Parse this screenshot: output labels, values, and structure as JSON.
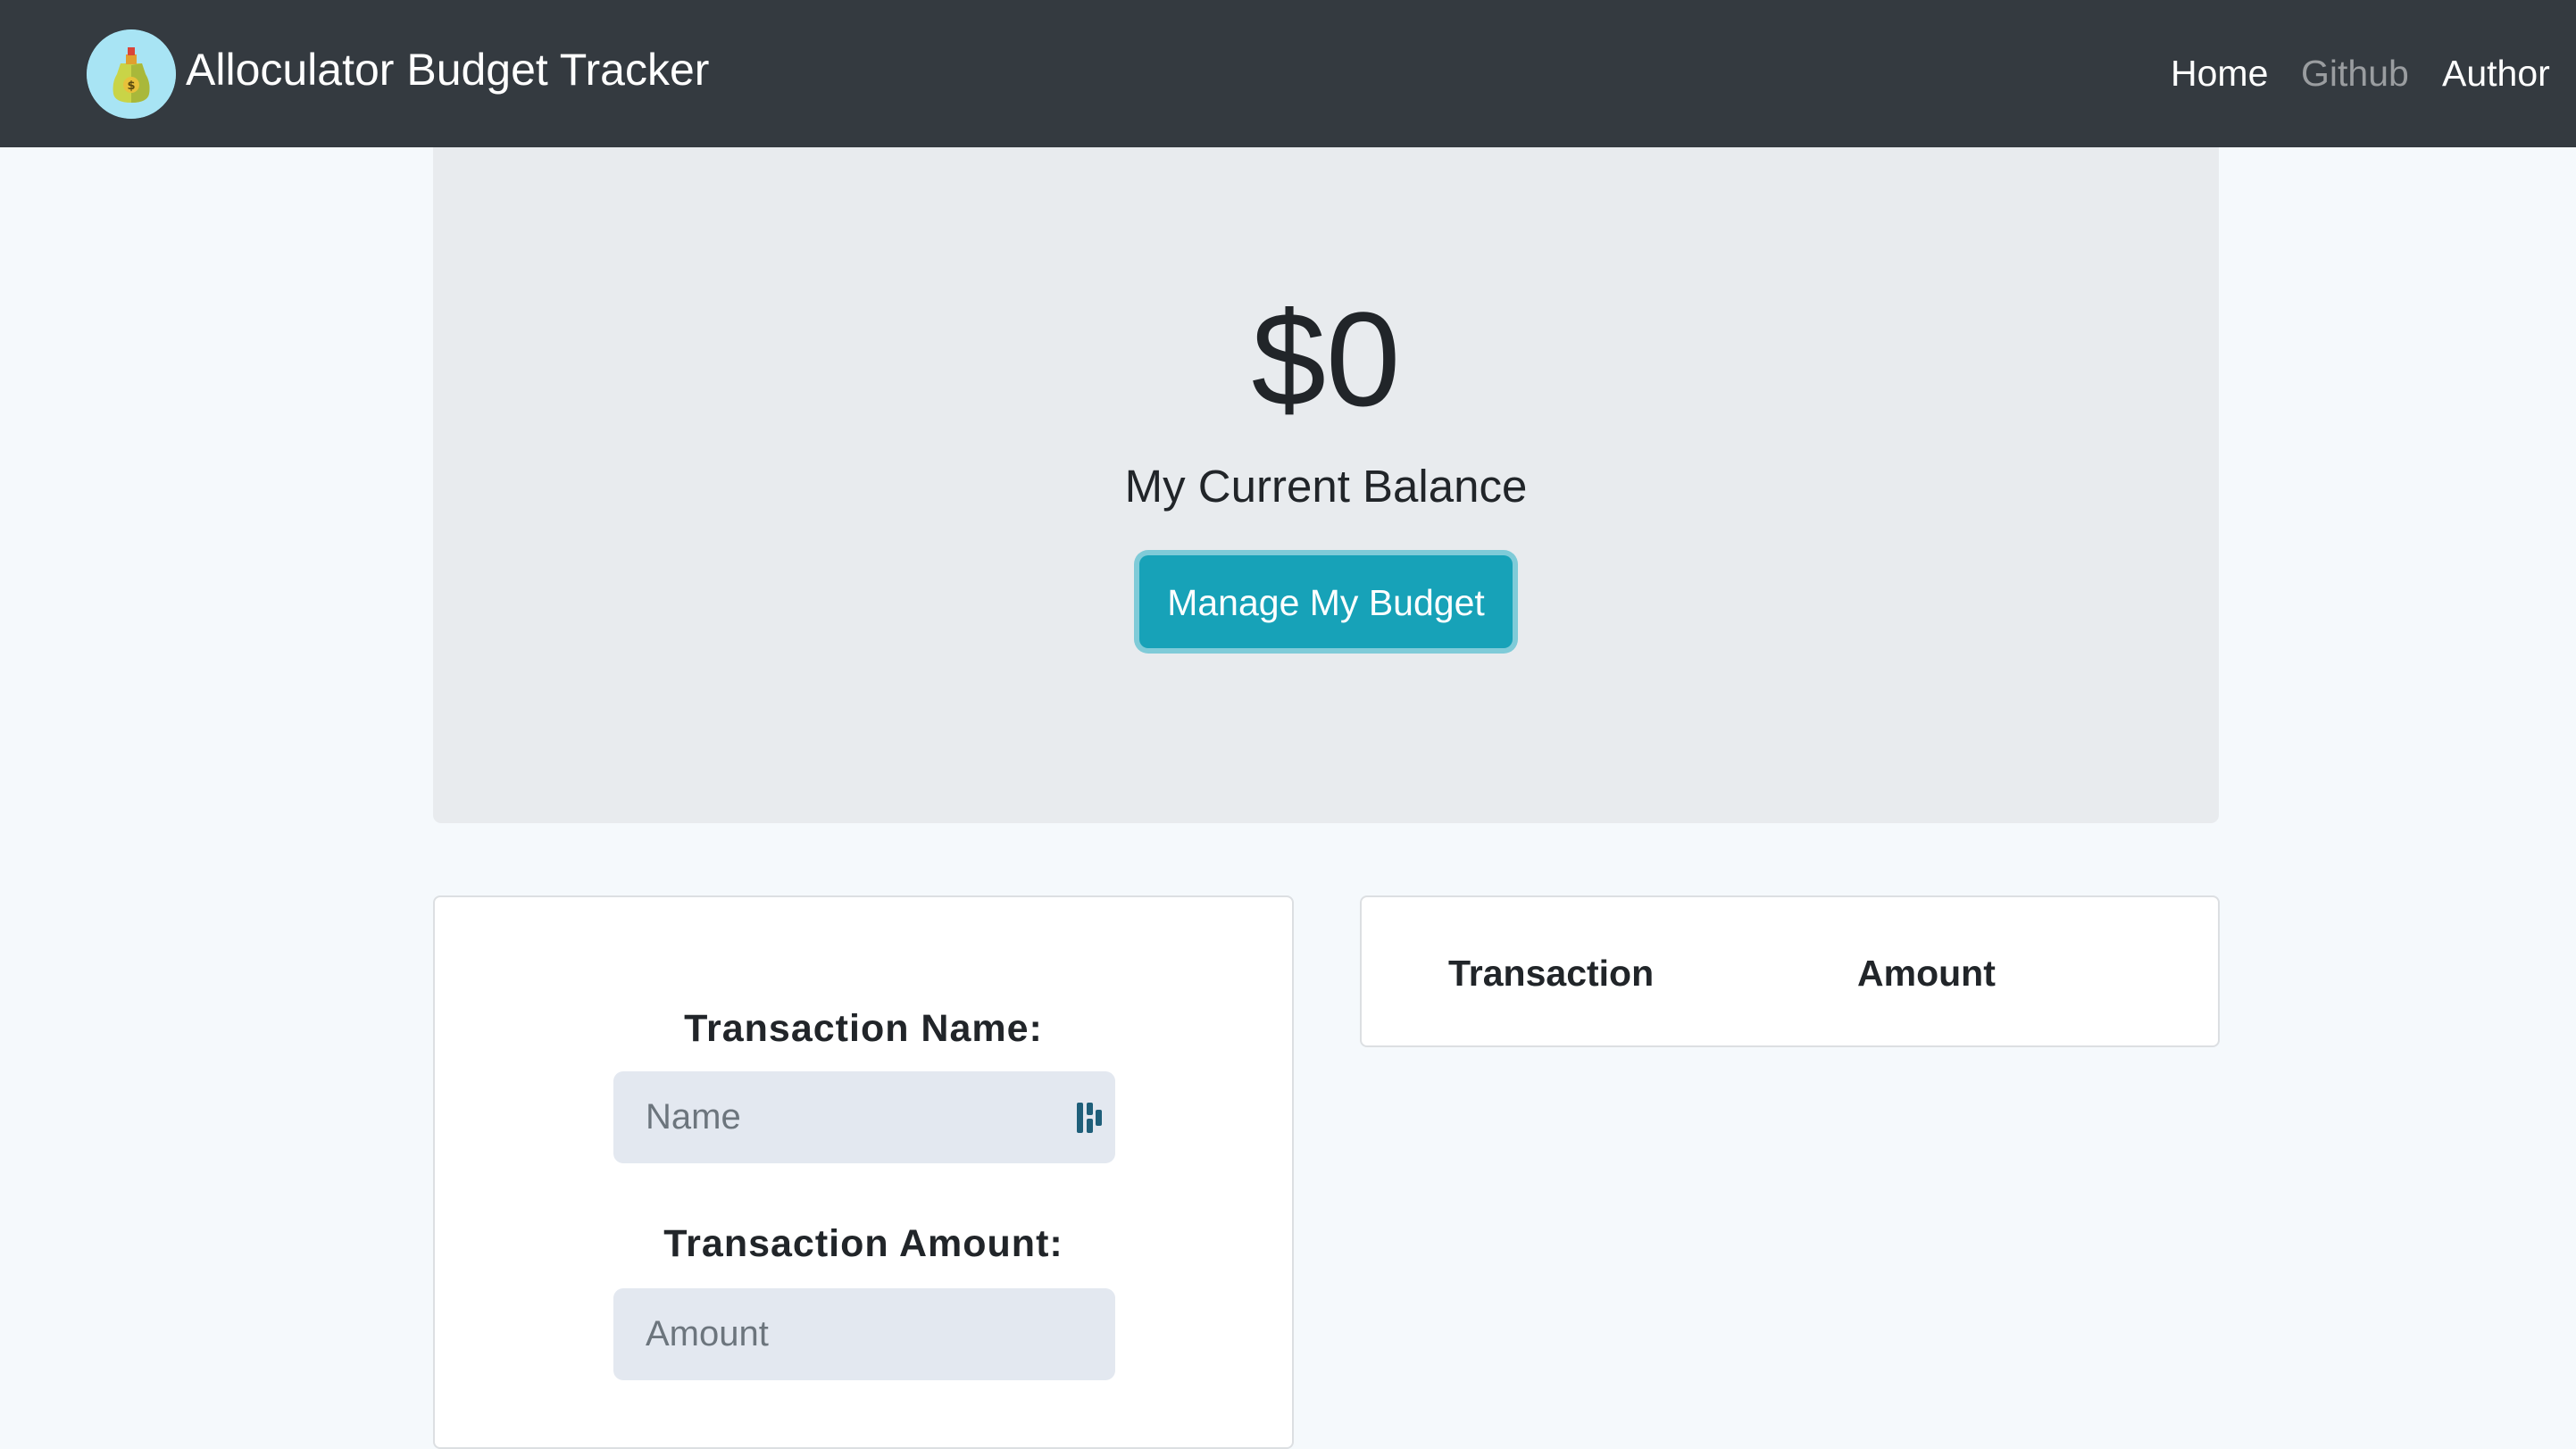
{
  "navbar": {
    "brand_title": "Alloculator Budget Tracker",
    "logo_icon": "money-bag-icon",
    "links": [
      {
        "label": "Home",
        "active": true
      },
      {
        "label": "Github",
        "active": false
      },
      {
        "label": "Author",
        "active": true
      }
    ]
  },
  "hero": {
    "balance": "$0",
    "balance_label": "My Current Balance",
    "manage_button": "Manage My Budget"
  },
  "form": {
    "name_label": "Transaction Name:",
    "name_placeholder": "Name",
    "amount_label": "Transaction Amount:",
    "amount_placeholder": "Amount",
    "autofill_icon": "password-manager-icon"
  },
  "table": {
    "columns": [
      "Transaction",
      "Amount"
    ],
    "rows": []
  },
  "colors": {
    "navbar": "#343a40",
    "accent": "#17a2b8",
    "jumbotron": "#e8ebee",
    "page_background": "#f5f9fc",
    "input_background": "#e3e8f0"
  }
}
